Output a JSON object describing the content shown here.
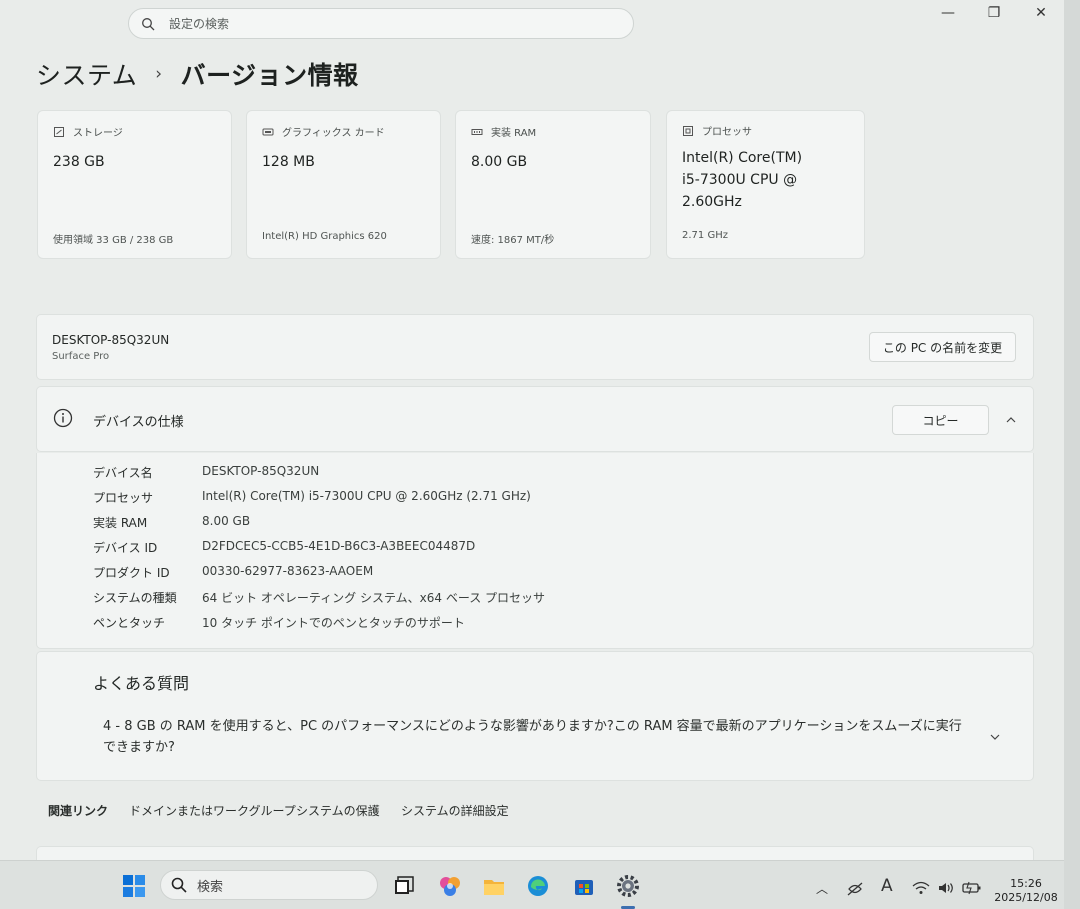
{
  "search": {
    "placeholder": "設定の検索"
  },
  "window": {
    "minimize": "—",
    "maximize": "❐",
    "close": "✕"
  },
  "breadcrumb": {
    "parent": "システム",
    "separator": "›",
    "current": "バージョン情報"
  },
  "cards": [
    {
      "icon": "storage-icon",
      "label": "ストレージ",
      "value": "238 GB",
      "sub": "使用領域 33 GB / 238 GB"
    },
    {
      "icon": "graphics-card-icon",
      "label": "グラフィックス カード",
      "value": "128 MB",
      "sub": "Intel(R) HD Graphics 620"
    },
    {
      "icon": "ram-icon",
      "label": "実装 RAM",
      "value": "8.00 GB",
      "sub": "速度: 1867 MT/秒"
    },
    {
      "icon": "processor-icon",
      "label": "プロセッサ",
      "value_lines": [
        "Intel(R) Core(TM)",
        "i5-7300U CPU @",
        "2.60GHz"
      ],
      "sub": "2.71 GHz"
    }
  ],
  "device": {
    "name": "DESKTOP-85Q32UN",
    "model": "Surface Pro",
    "rename_button": "この PC の名前を変更"
  },
  "specs": {
    "title": "デバイスの仕様",
    "copy_button": "コピー",
    "rows": [
      {
        "key": "デバイス名",
        "value": "DESKTOP-85Q32UN"
      },
      {
        "key": "プロセッサ",
        "value": "Intel(R) Core(TM) i5-7300U CPU @ 2.60GHz (2.71 GHz)"
      },
      {
        "key": "実装 RAM",
        "value": "8.00 GB"
      },
      {
        "key": "デバイス ID",
        "value": "D2FDCEC5-CCB5-4E1D-B6C3-A3BEEC04487D"
      },
      {
        "key": "プロダクト ID",
        "value": "00330-62977-83623-AAOEM"
      },
      {
        "key": "システムの種類",
        "value": "64 ビット オペレーティング システム、x64 ベース プロセッサ"
      },
      {
        "key": "ペンとタッチ",
        "value": "10 タッチ ポイントでのペンとタッチのサポート"
      }
    ]
  },
  "faq": {
    "title": "よくある質問",
    "question": "4 - 8 GB の RAM を使用すると、PC のパフォーマンスにどのような影響がありますか?この RAM 容量で最新のアプリケーションをスムーズに実行できますか?"
  },
  "related": {
    "title": "関連リンク",
    "links": [
      "ドメインまたはワークグループ",
      "システムの保護",
      "システムの詳細設定"
    ]
  },
  "taskbar": {
    "search_label": "検索",
    "ime": "A",
    "time": "15:26",
    "date": "2025/12/08"
  },
  "colors": {
    "accent": "#0067c0",
    "background": "#e9ecea",
    "card": "#f3f5f4"
  }
}
